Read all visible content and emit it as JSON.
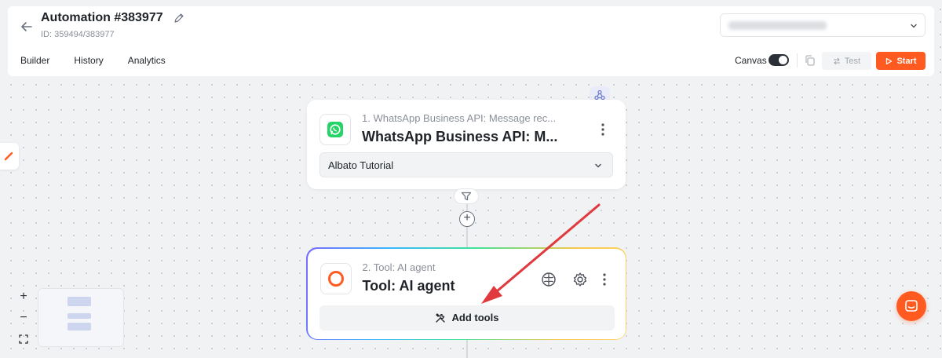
{
  "header": {
    "title": "Automation #383977",
    "subtitle": "ID: 359494/383977",
    "tabs": [
      {
        "label": "Builder"
      },
      {
        "label": "History"
      },
      {
        "label": "Analytics"
      }
    ],
    "canvas_toggle_label": "Canvas",
    "canvas_toggle_on": true,
    "test_label": "Test",
    "start_label": "Start"
  },
  "nodes": [
    {
      "step": "1. WhatsApp Business API: Message rec...",
      "title": "WhatsApp Business API: M...",
      "icon": "whatsapp-icon",
      "connection": "Albato Tutorial"
    },
    {
      "step": "2. Tool: AI agent",
      "title": "Tool: AI agent",
      "icon": "ai-agent-icon",
      "action_label": "Add tools"
    }
  ],
  "colors": {
    "accent": "#ff5a1f",
    "whatsapp": "#25d366",
    "annotation_arrow": "#e0393e"
  }
}
